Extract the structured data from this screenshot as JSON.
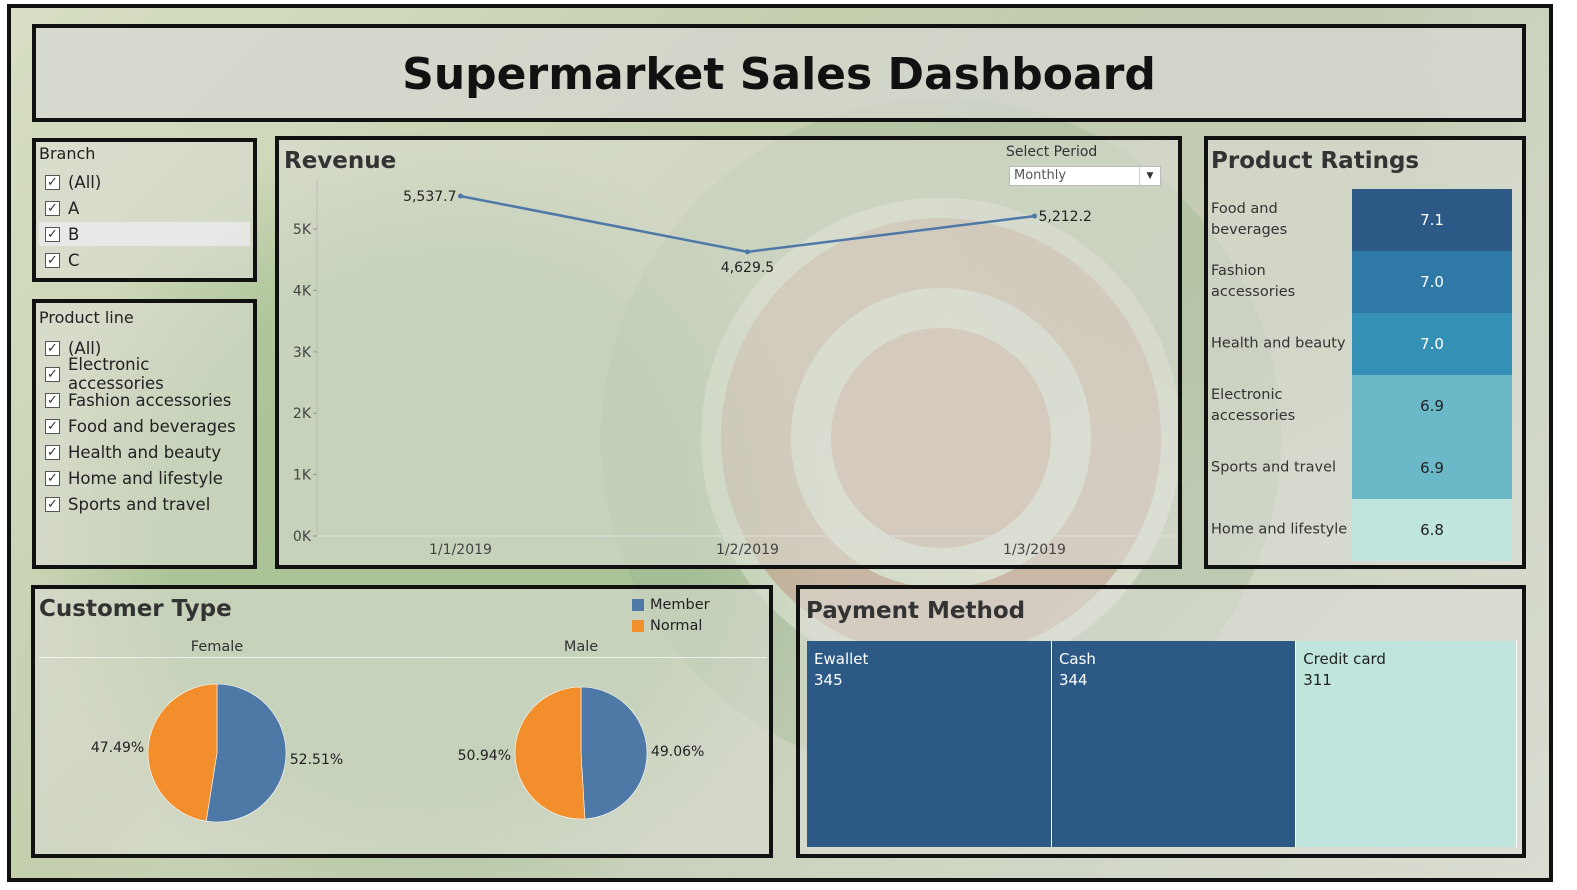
{
  "dashboard": {
    "title": "Supermarket Sales Dashboard"
  },
  "branch_filter": {
    "title": "Branch",
    "items": [
      {
        "label": "(All)",
        "checked": true
      },
      {
        "label": "A",
        "checked": true
      },
      {
        "label": "B",
        "checked": true
      },
      {
        "label": "C",
        "checked": true
      }
    ]
  },
  "product_line_filter": {
    "title": "Product line",
    "items": [
      {
        "label": "(All)",
        "checked": true
      },
      {
        "label": "Electronic accessories",
        "checked": true
      },
      {
        "label": "Fashion accessories",
        "checked": true
      },
      {
        "label": "Food and beverages",
        "checked": true
      },
      {
        "label": "Health and beauty",
        "checked": true
      },
      {
        "label": "Home and lifestyle",
        "checked": true
      },
      {
        "label": "Sports and travel",
        "checked": true
      }
    ]
  },
  "revenue": {
    "title": "Revenue",
    "period_label": "Select Period",
    "period_value": "Monthly",
    "chart_data": {
      "type": "line",
      "x": [
        "1/1/2019",
        "1/2/2019",
        "1/3/2019"
      ],
      "y_tick_labels": [
        "0K",
        "1K",
        "2K",
        "3K",
        "4K",
        "5K"
      ],
      "y_ticks": [
        0,
        1000,
        2000,
        3000,
        4000,
        5000
      ],
      "ylim": [
        0,
        5800
      ],
      "series": [
        {
          "values": [
            5537.7,
            4629.5,
            5212.2
          ],
          "labels": [
            "5,537.7",
            "4,629.5",
            "5,212.2"
          ],
          "color": "#4e79a7"
        }
      ]
    }
  },
  "ratings": {
    "title": "Product Ratings",
    "rows": [
      {
        "label": "Food and beverages",
        "value": "7.1",
        "color": "#2c5985",
        "text_color": "#ffffff"
      },
      {
        "label": "Fashion accessories",
        "value": "7.0",
        "color": "#2e79a5",
        "text_color": "#ffffff"
      },
      {
        "label": "Health and beauty",
        "value": "7.0",
        "color": "#3490b5",
        "text_color": "#ffffff"
      },
      {
        "label": "Electronic accessories",
        "value": "6.9",
        "color": "#6bb8c8",
        "text_color": "#222222"
      },
      {
        "label": "Sports and travel",
        "value": "6.9",
        "color": "#6bb8c8",
        "text_color": "#222222"
      },
      {
        "label": "Home and lifestyle",
        "value": "6.8",
        "color": "#bfe5dd",
        "text_color": "#222222"
      }
    ]
  },
  "customer_type": {
    "title": "Customer Type",
    "legend": [
      {
        "label": "Member",
        "color": "#4e79a7"
      },
      {
        "label": "Normal",
        "color": "#f28e2b"
      }
    ],
    "chart_data": {
      "type": "pie",
      "pies": [
        {
          "header": "Female",
          "member": 52.51,
          "normal": 47.49,
          "member_label": "52.51%",
          "normal_label": "47.49%"
        },
        {
          "header": "Male",
          "member": 49.06,
          "normal": 50.94,
          "member_label": "49.06%",
          "normal_label": "50.94%"
        }
      ]
    }
  },
  "payment": {
    "title": "Payment Method",
    "cells": [
      {
        "label": "Ewallet",
        "count": "345",
        "value": 345,
        "color": "#2c5985",
        "text_color": "#ffffff"
      },
      {
        "label": "Cash",
        "count": "344",
        "value": 344,
        "color": "#2c5985",
        "text_color": "#ffffff"
      },
      {
        "label": "Credit card",
        "count": "311",
        "value": 311,
        "color": "#bfe5dd",
        "text_color": "#222222"
      }
    ]
  }
}
